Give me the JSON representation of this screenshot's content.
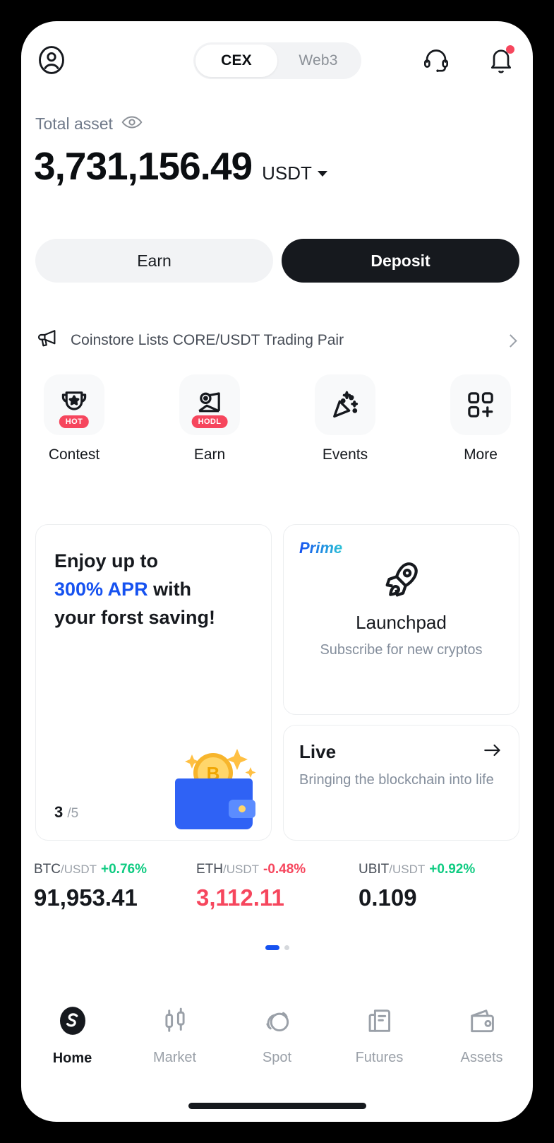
{
  "header": {
    "profile_icon": "user-circle-icon",
    "segments": [
      {
        "label": "CEX",
        "active": true
      },
      {
        "label": "Web3",
        "active": false
      }
    ],
    "support_icon": "headset-icon",
    "notification_icon": "bell-icon",
    "notification_has_badge": true
  },
  "balance": {
    "label": "Total asset",
    "eye_icon": "eye-icon",
    "amount": "3,731,156.49",
    "currency": "USDT"
  },
  "actions": {
    "earn_label": "Earn",
    "deposit_label": "Deposit"
  },
  "announcement": {
    "icon": "megaphone-icon",
    "text": "Coinstore Lists CORE/USDT Trading Pair",
    "chevron": "chevron-right-icon"
  },
  "quick_actions": [
    {
      "label": "Contest",
      "icon": "trophy-icon",
      "badge": "HOT"
    },
    {
      "label": "Earn",
      "icon": "hand-coin-icon",
      "badge": "HODL"
    },
    {
      "label": "Events",
      "icon": "confetti-icon",
      "badge": ""
    },
    {
      "label": "More",
      "icon": "grid-plus-icon",
      "badge": ""
    }
  ],
  "promo_card": {
    "line1": "Enjoy up to",
    "highlight": "300% APR",
    "line2_tail": " with",
    "line3": "your forst saving!",
    "current": "3",
    "total": "/5",
    "art_icon": "wallet-bitcoin-icon"
  },
  "launchpad_card": {
    "tag": "Prime",
    "icon": "rocket-icon",
    "title": "Launchpad",
    "subtitle": "Subscribe for new cryptos"
  },
  "live_card": {
    "title": "Live",
    "arrow_icon": "arrow-right-icon",
    "subtitle": "Bringing the blockchain into life"
  },
  "tickers": [
    {
      "base": "BTC",
      "quote": "/USDT",
      "change": "+0.76%",
      "direction": "up",
      "price": "91,953.41"
    },
    {
      "base": "ETH",
      "quote": "/USDT",
      "change": "-0.48%",
      "direction": "down",
      "price": "3,112.11"
    },
    {
      "base": "UBIT",
      "quote": "/USDT",
      "change": "+0.92%",
      "direction": "up",
      "price": "0.109"
    }
  ],
  "carousel": {
    "pages": 2,
    "active": 0
  },
  "bottom_nav": [
    {
      "label": "Home",
      "icon": "coinstore-logo-icon",
      "active": true
    },
    {
      "label": "Market",
      "icon": "candlestick-icon",
      "active": false
    },
    {
      "label": "Spot",
      "icon": "spot-swap-icon",
      "active": false
    },
    {
      "label": "Futures",
      "icon": "futures-doc-icon",
      "active": false
    },
    {
      "label": "Assets",
      "icon": "wallet-icon",
      "active": false
    }
  ],
  "colors": {
    "up": "#0ecb81",
    "down": "#f6465d",
    "accent_blue": "#1652f0",
    "primary_dark": "#16191e",
    "badge_red": "#f6465d"
  }
}
